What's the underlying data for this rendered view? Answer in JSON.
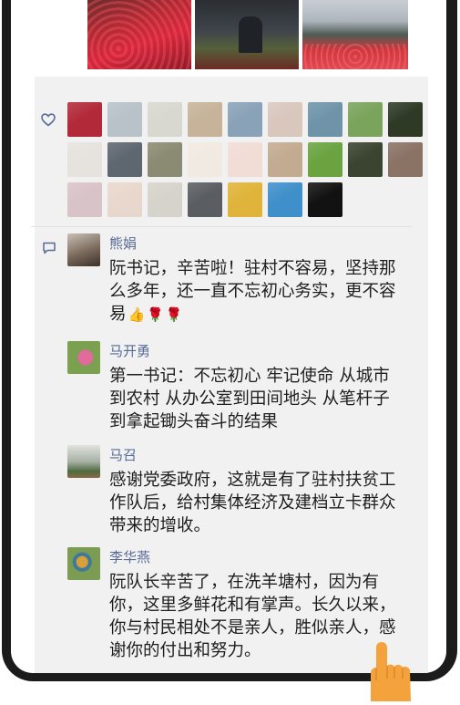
{
  "moments": {
    "photos": [
      {
        "name": "red-flower-field-photo"
      },
      {
        "name": "greenhouse-people-photo"
      },
      {
        "name": "flower-nursery-photo"
      }
    ],
    "likes": {
      "icon": "heart-outline-icon",
      "avatars": [
        {
          "name": "avatar-red-flowers",
          "color": "#b22a3a"
        },
        {
          "name": "avatar-man-portrait",
          "color": "#b9c2c9"
        },
        {
          "name": "avatar-sketch-art",
          "color": "#d8d8d0"
        },
        {
          "name": "avatar-child",
          "color": "#c7b39a"
        },
        {
          "name": "avatar-baby-blue",
          "color": "#8aa2b8"
        },
        {
          "name": "avatar-couple",
          "color": "#d9c7bd"
        },
        {
          "name": "avatar-lake-landscape",
          "color": "#6f94a9"
        },
        {
          "name": "avatar-bird-branch",
          "color": "#7aa35c"
        },
        {
          "name": "avatar-white-flower",
          "color": "#2f3a26"
        },
        {
          "name": "avatar-woman-white",
          "color": "#e6e3de"
        },
        {
          "name": "avatar-man-dark",
          "color": "#5e6670"
        },
        {
          "name": "avatar-person-field",
          "color": "#8b8a72"
        },
        {
          "name": "avatar-party-badge",
          "color": "#f0eae2"
        },
        {
          "name": "avatar-family-poster",
          "color": "#f1dcd6"
        },
        {
          "name": "avatar-man-smile",
          "color": "#c2ab90"
        },
        {
          "name": "avatar-green-plant",
          "color": "#6aa340"
        },
        {
          "name": "avatar-dark-scenery",
          "color": "#3a4430"
        },
        {
          "name": "avatar-group-photo",
          "color": "#8a7265"
        },
        {
          "name": "avatar-dancer",
          "color": "#d8c3c8"
        },
        {
          "name": "avatar-woman-portrait",
          "color": "#e8d7cc"
        },
        {
          "name": "avatar-girl-white",
          "color": "#d6d3cc"
        },
        {
          "name": "avatar-car",
          "color": "#5a5e62"
        },
        {
          "name": "avatar-yellow-dog",
          "color": "#e0b43a"
        },
        {
          "name": "avatar-blue-sky",
          "color": "#3f8fca"
        },
        {
          "name": "avatar-dark-blank",
          "color": "#121212"
        }
      ]
    },
    "comments_icon": "comment-bubble-icon",
    "comments": [
      {
        "author": "熊娟",
        "avatar_color": "#7b6a5c",
        "lines": [
          "阮书记，辛苦啦！驻村不容易，坚持那",
          "么多年，还一直不忘初心务实，更不容",
          "易"
        ],
        "emoji": [
          "thumbs-up-icon",
          "rose-icon",
          "rose-icon"
        ]
      },
      {
        "author": "马开勇",
        "avatar_color": "#6b8a4c",
        "lines": [
          "第一书记：不忘初心 牢记使命 从城市",
          "到农村 从办公室到田间地头 从笔杆子",
          "到拿起锄头奋斗的结果"
        ]
      },
      {
        "author": "马召",
        "avatar_color": "#a8b1a6",
        "lines": [
          "感谢党委政府，这就是有了驻村扶贫工",
          "作队后，给村集体经济及建档立卡群众",
          "带来的增收。"
        ]
      },
      {
        "author": "李华燕",
        "avatar_color": "#7c9b53",
        "lines": [
          "阮队长辛苦了，在洗羊塘村，因为有",
          "你，这里多鲜花和有掌声。长久以来，",
          "你与村民相处不是亲人，胜似亲人，感",
          "谢你的付出和努力。"
        ]
      }
    ],
    "hand_icon": "pointing-hand-icon"
  }
}
